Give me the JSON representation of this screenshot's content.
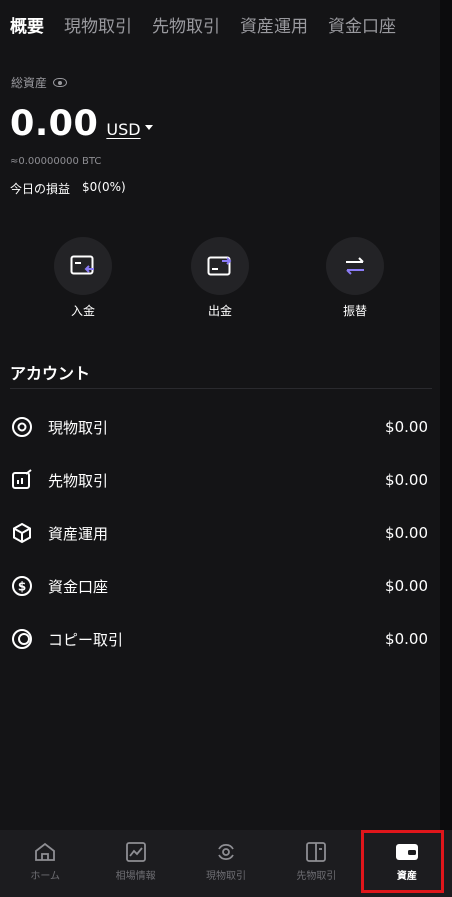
{
  "top_tabs": [
    {
      "label": "概要"
    },
    {
      "label": "現物取引"
    },
    {
      "label": "先物取引"
    },
    {
      "label": "資産運用"
    },
    {
      "label": "資金口座"
    }
  ],
  "summary": {
    "total_label": "総資産",
    "balance": "0.00",
    "currency": "USD",
    "btc_equiv": "≈0.00000000 BTC",
    "pnl_label": "今日の損益",
    "pnl_value": "$0(0%)"
  },
  "actions": [
    {
      "label": "入金",
      "icon": "deposit-icon"
    },
    {
      "label": "出金",
      "icon": "withdraw-icon"
    },
    {
      "label": "振替",
      "icon": "transfer-icon"
    }
  ],
  "accounts_title": "アカウント",
  "accounts": [
    {
      "name": "現物取引",
      "amount": "$0.00",
      "icon": "spot-icon"
    },
    {
      "name": "先物取引",
      "amount": "$0.00",
      "icon": "futures-icon"
    },
    {
      "name": "資産運用",
      "amount": "$0.00",
      "icon": "earn-icon"
    },
    {
      "name": "資金口座",
      "amount": "$0.00",
      "icon": "funding-icon"
    },
    {
      "name": "コピー取引",
      "amount": "$0.00",
      "icon": "copy-trade-icon"
    }
  ],
  "bottom_nav": [
    {
      "label": "ホーム",
      "icon": "home-icon"
    },
    {
      "label": "相場情報",
      "icon": "market-icon"
    },
    {
      "label": "現物取引",
      "icon": "spot-trade-icon"
    },
    {
      "label": "先物取引",
      "icon": "futures-trade-icon"
    },
    {
      "label": "資産",
      "icon": "wallet-icon",
      "active": true
    }
  ],
  "colors": {
    "background": "#141416",
    "accent_purple": "#8b7cf6",
    "highlight_red": "#e0161b"
  }
}
